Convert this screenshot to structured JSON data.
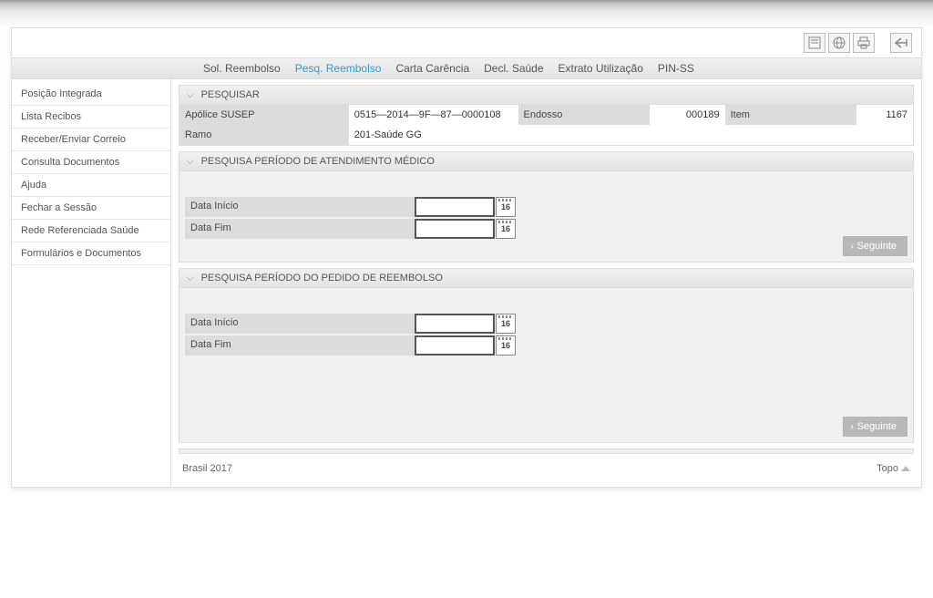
{
  "tabs": {
    "sol": "Sol. Reembolso",
    "pesq": "Pesq. Reembolso",
    "carta": "Carta Carência",
    "decl": "Decl. Saúde",
    "extrato": "Extrato Utilização",
    "pin": "PIN-SS"
  },
  "sidebar": {
    "items": [
      "Posição Integrada",
      "Lista Recibos",
      "Receber/Enviar Correio",
      "Consulta Documentos",
      "Ajuda",
      "Fechar a Sessão",
      "Rede Referenciada Saúde",
      "Formulários e Documentos"
    ]
  },
  "panels": {
    "pesquisar": {
      "title": "PESQUISAR",
      "apolice_lbl": "Apólice SUSEP",
      "apolice_val": "0515—2014—9F—87—0000108",
      "endosso_lbl": "Endosso",
      "endosso_val": "000189",
      "item_lbl": "Item",
      "item_val": "1167",
      "ramo_lbl": "Ramo",
      "ramo_val": "201-Saúde GG"
    },
    "periodo_atend": {
      "title": "PESQUISA PERÍODO DE ATENDIMENTO MÉDICO",
      "inicio_lbl": "Data Início",
      "fim_lbl": "Data Fim",
      "cal_text": "16"
    },
    "periodo_pedido": {
      "title": "PESQUISA PERÍODO DO PEDIDO DE REEMBOLSO",
      "inicio_lbl": "Data Início",
      "fim_lbl": "Data Fim",
      "cal_text": "16"
    }
  },
  "buttons": {
    "seguinte": "Seguinte"
  },
  "footer": {
    "left": "Brasil 2017",
    "topo": "Topo"
  }
}
